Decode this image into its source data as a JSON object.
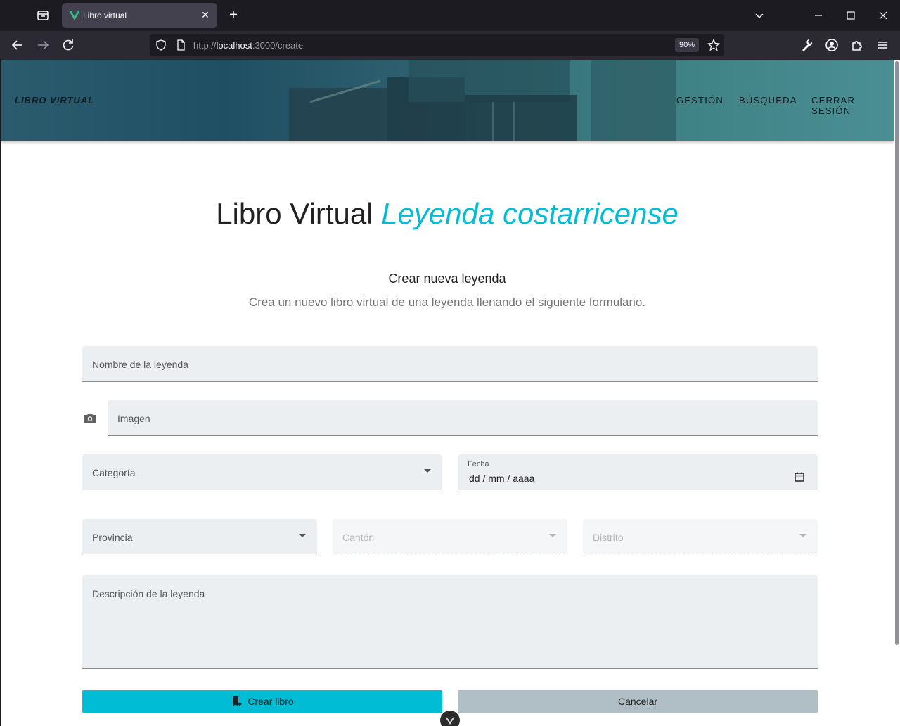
{
  "browser": {
    "tab_title": "Libro virtual",
    "url_prefix": "http://",
    "url_host": "localhost",
    "url_path": ":3000/create",
    "zoom": "90%"
  },
  "header": {
    "brand": "LIBRO VIRTUAL",
    "menu": [
      "GESTIÓN",
      "BÚSQUEDA",
      "CERRAR SESIÓN"
    ]
  },
  "main": {
    "title_plain": "Libro Virtual",
    "title_accent": "Leyenda costarricense",
    "subtitle": "Crear nueva leyenda",
    "description": "Crea un nuevo libro virtual de una leyenda llenando el siguiente formulario."
  },
  "form": {
    "name_label": "Nombre de la leyenda",
    "image_label": "Imagen",
    "category_label": "Categoría",
    "date_label": "Fecha",
    "date_value": "dd / mm / aaaa",
    "province_label": "Provincia",
    "canton_label": "Cantón",
    "district_label": "Distrito",
    "description_label": "Descripción de la leyenda",
    "submit_label": "Crear libro",
    "cancel_label": "Cancelar"
  },
  "colors": {
    "accent": "#00bcd4",
    "cancel": "#b0bec5",
    "field_bg": "#eceff1"
  }
}
